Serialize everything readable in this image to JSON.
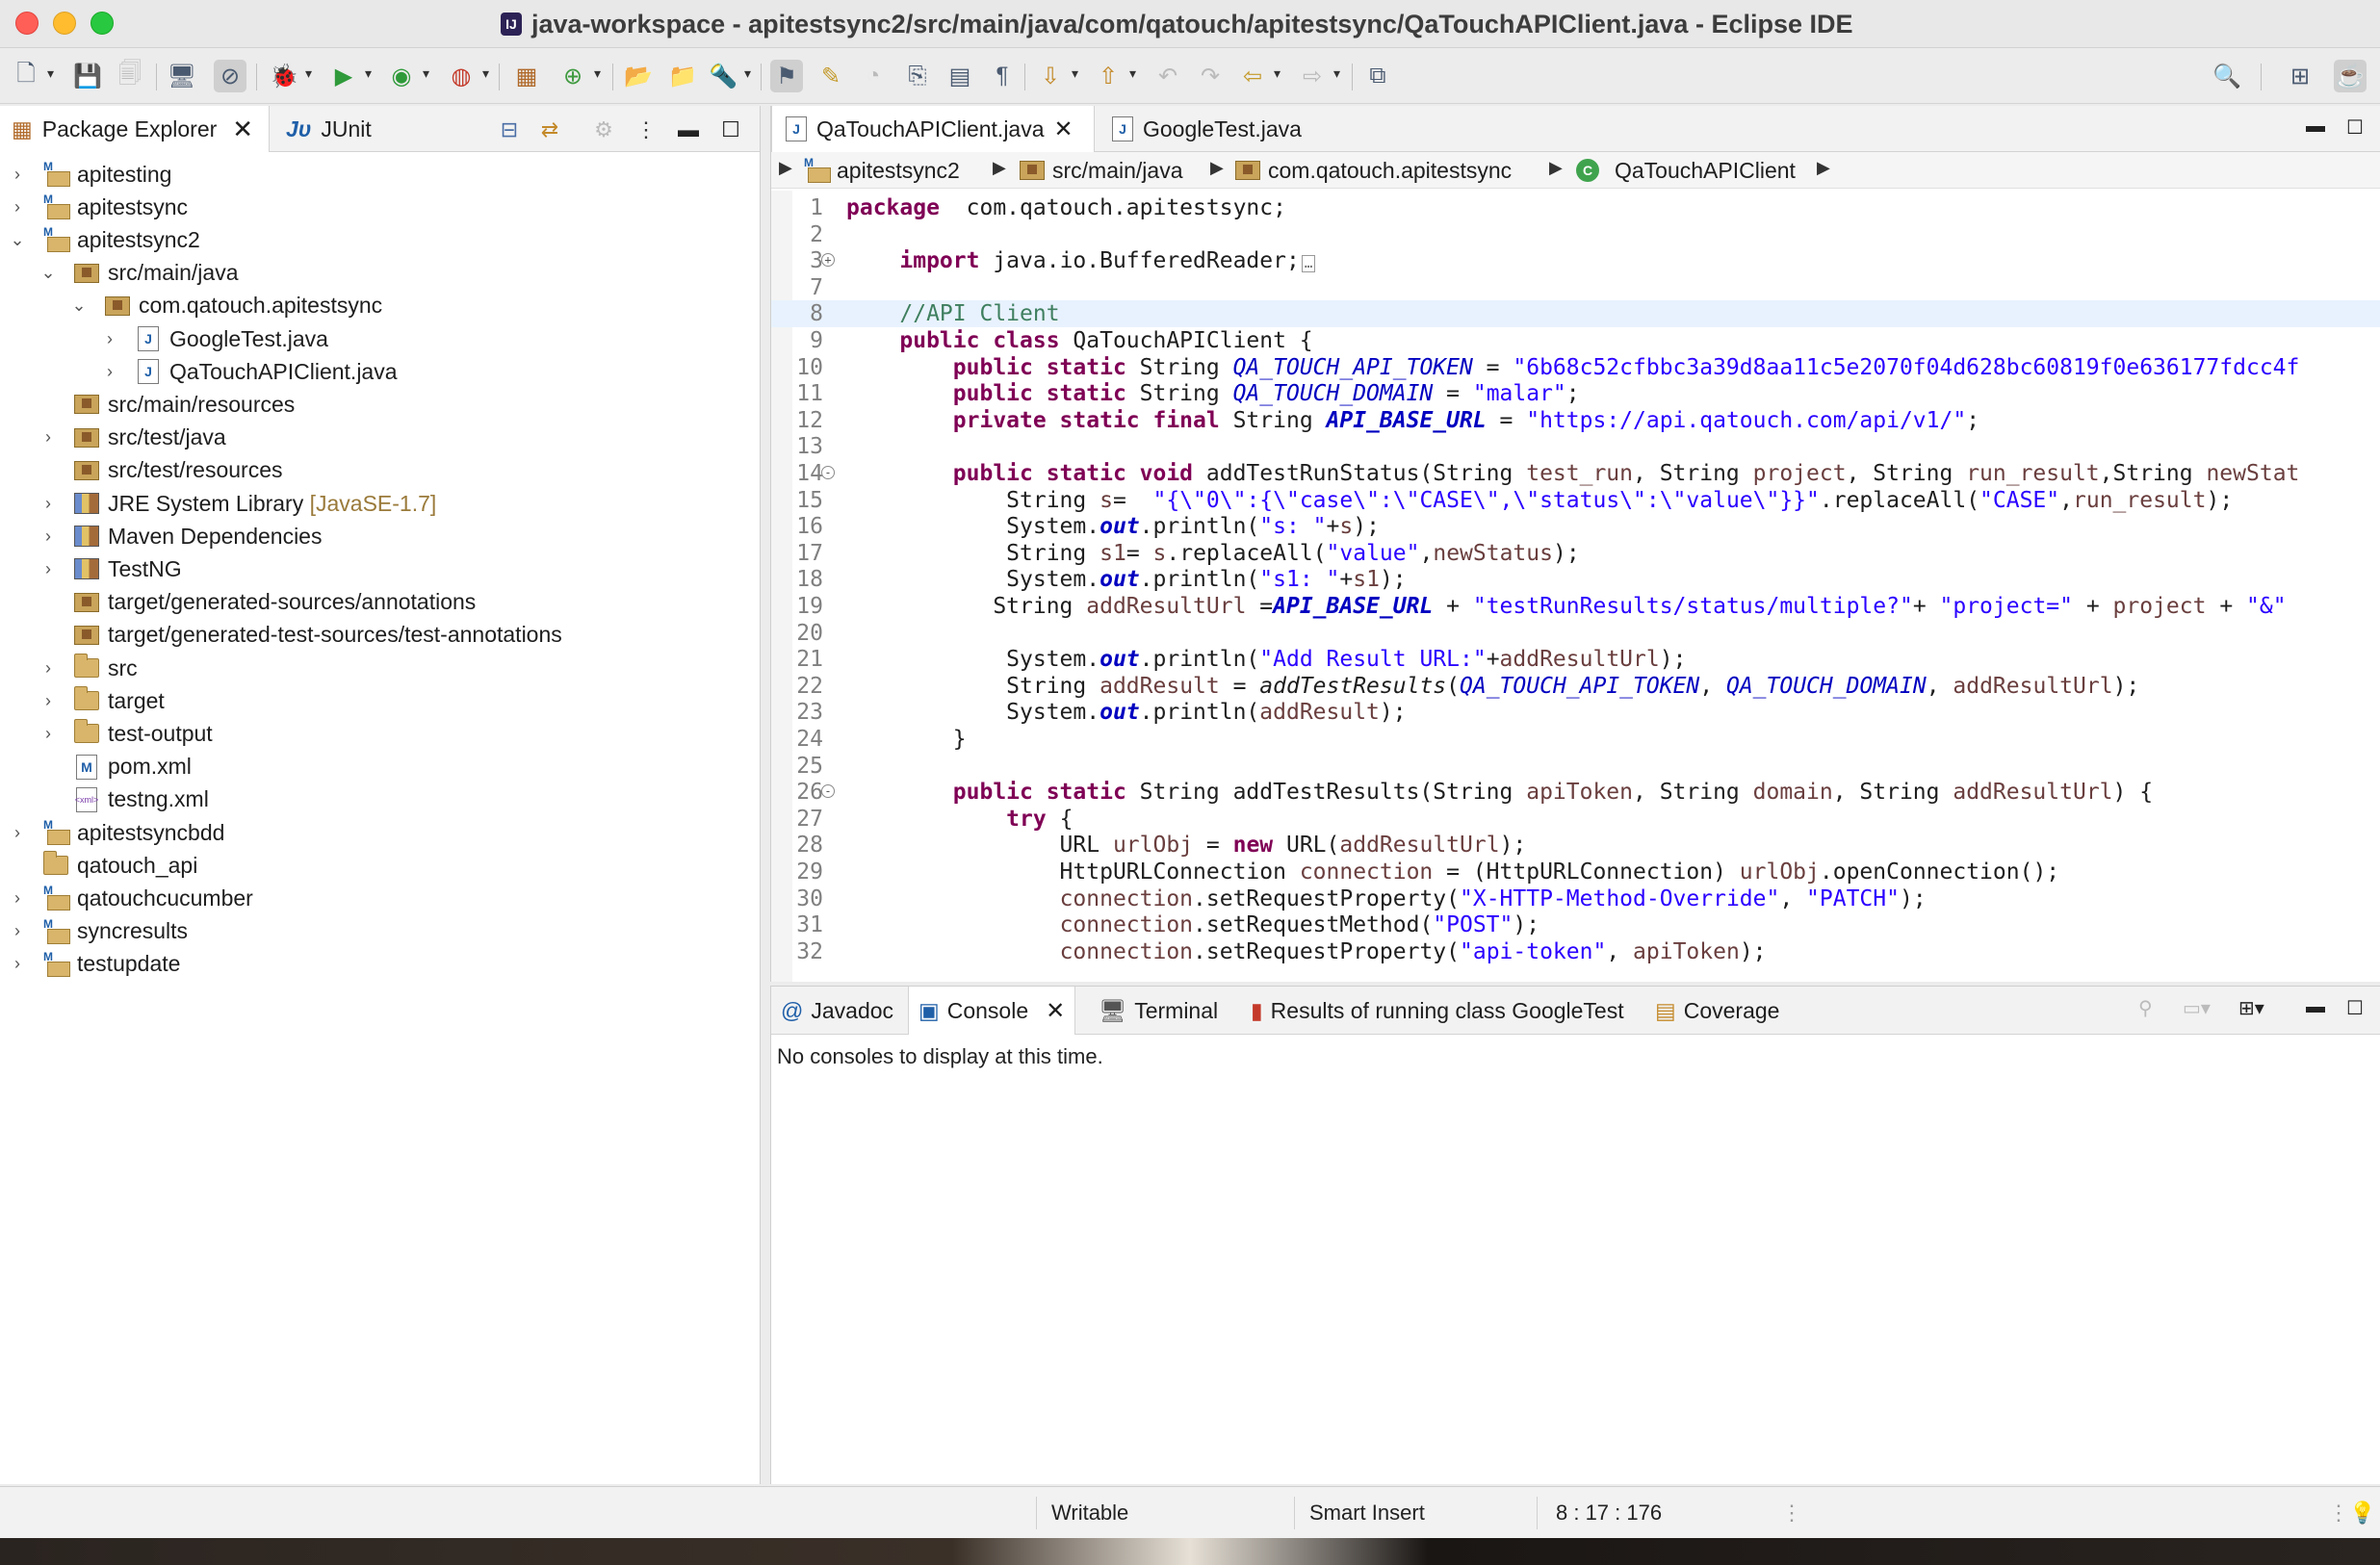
{
  "window": {
    "title": "java-workspace - apitestsync2/src/main/java/com/qatouch/apitestsync/QaTouchAPIClient.java - Eclipse IDE"
  },
  "left_panel": {
    "tabs": [
      {
        "label": "Package Explorer",
        "active": true
      },
      {
        "label": "JUnit",
        "active": false
      }
    ],
    "tree": [
      {
        "label": "apitesting",
        "suffix": "",
        "level": 0,
        "twisty": "›",
        "icon": "project"
      },
      {
        "label": "apitestsync",
        "suffix": "",
        "level": 0,
        "twisty": "›",
        "icon": "project"
      },
      {
        "label": "apitestsync2",
        "suffix": "",
        "level": 0,
        "twisty": "⌄",
        "icon": "project"
      },
      {
        "label": "src/main/java",
        "suffix": "",
        "level": 1,
        "twisty": "⌄",
        "icon": "pkgfolder"
      },
      {
        "label": "com.qatouch.apitestsync",
        "suffix": "",
        "level": 2,
        "twisty": "⌄",
        "icon": "pkgfolder"
      },
      {
        "label": "GoogleTest.java",
        "suffix": "",
        "level": 3,
        "twisty": "›",
        "icon": "jfile"
      },
      {
        "label": "QaTouchAPIClient.java",
        "suffix": "",
        "level": 3,
        "twisty": "›",
        "icon": "jfile"
      },
      {
        "label": "src/main/resources",
        "suffix": "",
        "level": 1,
        "twisty": "",
        "icon": "pkgfolder"
      },
      {
        "label": "src/test/java",
        "suffix": "",
        "level": 1,
        "twisty": "›",
        "icon": "pkgfolder"
      },
      {
        "label": "src/test/resources",
        "suffix": "",
        "level": 1,
        "twisty": "",
        "icon": "pkgfolder"
      },
      {
        "label": "JRE System Library ",
        "suffix": "[JavaSE-1.7]",
        "level": 1,
        "twisty": "›",
        "icon": "lib"
      },
      {
        "label": "Maven Dependencies",
        "suffix": "",
        "level": 1,
        "twisty": "›",
        "icon": "lib"
      },
      {
        "label": "TestNG",
        "suffix": "",
        "level": 1,
        "twisty": "›",
        "icon": "lib"
      },
      {
        "label": "target/generated-sources/annotations",
        "suffix": "",
        "level": 1,
        "twisty": "",
        "icon": "pkgfolder"
      },
      {
        "label": "target/generated-test-sources/test-annotations",
        "suffix": "",
        "level": 1,
        "twisty": "",
        "icon": "pkgfolder"
      },
      {
        "label": "src",
        "suffix": "",
        "level": 1,
        "twisty": "›",
        "icon": "folder"
      },
      {
        "label": "target",
        "suffix": "",
        "level": 1,
        "twisty": "›",
        "icon": "folder"
      },
      {
        "label": "test-output",
        "suffix": "",
        "level": 1,
        "twisty": "›",
        "icon": "folder"
      },
      {
        "label": "pom.xml",
        "suffix": "",
        "level": 1,
        "twisty": "",
        "icon": "pomfile"
      },
      {
        "label": "testng.xml",
        "suffix": "",
        "level": 1,
        "twisty": "",
        "icon": "xmlfile"
      },
      {
        "label": "apitestsyncbdd",
        "suffix": "",
        "level": 0,
        "twisty": "›",
        "icon": "project"
      },
      {
        "label": "qatouch_api",
        "suffix": "",
        "level": 0,
        "twisty": "",
        "icon": "folder"
      },
      {
        "label": "qatouchcucumber",
        "suffix": "",
        "level": 0,
        "twisty": "›",
        "icon": "project"
      },
      {
        "label": "syncresults",
        "suffix": "",
        "level": 0,
        "twisty": "›",
        "icon": "project"
      },
      {
        "label": "testupdate",
        "suffix": "",
        "level": 0,
        "twisty": "›",
        "icon": "project"
      }
    ]
  },
  "editor": {
    "tabs": [
      {
        "label": "QaTouchAPIClient.java",
        "active": true
      },
      {
        "label": "GoogleTest.java",
        "active": false
      }
    ],
    "breadcrumb": [
      "apitestsync2",
      "src/main/java",
      "com.qatouch.apitestsync",
      "QaTouchAPIClient"
    ],
    "current_line": 8,
    "lines": [
      {
        "n": "1",
        "fold": "",
        "segs": [
          [
            "kw",
            "package"
          ],
          [
            "",
            "  com.qatouch.apitestsync;"
          ]
        ]
      },
      {
        "n": "2",
        "fold": "",
        "segs": []
      },
      {
        "n": "3",
        "fold": "+",
        "segs": [
          [
            "",
            "    "
          ],
          [
            "kw",
            "import"
          ],
          [
            "",
            " java.io.BufferedReader;"
          ],
          [
            "box",
            "…"
          ]
        ]
      },
      {
        "n": "7",
        "fold": "",
        "segs": []
      },
      {
        "n": "8",
        "fold": "",
        "segs": [
          [
            "",
            "    "
          ],
          [
            "cm",
            "//API Client"
          ]
        ]
      },
      {
        "n": "9",
        "fold": "",
        "segs": [
          [
            "",
            "    "
          ],
          [
            "kw",
            "public class"
          ],
          [
            "",
            " QaTouchAPIClient {"
          ]
        ]
      },
      {
        "n": "10",
        "fold": "",
        "segs": [
          [
            "",
            "        "
          ],
          [
            "kw",
            "public static"
          ],
          [
            "",
            " String "
          ],
          [
            "sf",
            "QA_TOUCH_API_TOKEN"
          ],
          [
            "",
            " = "
          ],
          [
            "str",
            "\"6b68c52cfbbc3a39d8aa11c5e2070f04d628bc60819f0e636177fdcc4f"
          ]
        ]
      },
      {
        "n": "11",
        "fold": "",
        "segs": [
          [
            "",
            "        "
          ],
          [
            "kw",
            "public static"
          ],
          [
            "",
            " String "
          ],
          [
            "sf",
            "QA_TOUCH_DOMAIN"
          ],
          [
            "",
            " = "
          ],
          [
            "str",
            "\"malar\""
          ],
          [
            "",
            ";"
          ]
        ]
      },
      {
        "n": "12",
        "fold": "",
        "segs": [
          [
            "",
            "        "
          ],
          [
            "kw",
            "private static final"
          ],
          [
            "",
            " String "
          ],
          [
            "sfb",
            "API_BASE_URL"
          ],
          [
            "",
            " = "
          ],
          [
            "str",
            "\"https://api.qatouch.com/api/v1/\""
          ],
          [
            "",
            ";"
          ]
        ]
      },
      {
        "n": "13",
        "fold": "",
        "segs": []
      },
      {
        "n": "14",
        "fold": "-",
        "segs": [
          [
            "",
            "        "
          ],
          [
            "kw",
            "public static void"
          ],
          [
            "",
            " addTestRunStatus(String "
          ],
          [
            "var",
            "test_run"
          ],
          [
            "",
            ", String "
          ],
          [
            "var",
            "project"
          ],
          [
            "",
            ", String "
          ],
          [
            "var",
            "run_result"
          ],
          [
            "",
            ",String "
          ],
          [
            "var",
            "newStat"
          ]
        ]
      },
      {
        "n": "15",
        "fold": "",
        "segs": [
          [
            "",
            "            String "
          ],
          [
            "var",
            "s"
          ],
          [
            "",
            "=  "
          ],
          [
            "str",
            "\"{\\\"0\\\":{\\\"case\\\":\\\"CASE\\\",\\\"status\\\":\\\"value\\\"}}\""
          ],
          [
            "",
            ".replaceAll("
          ],
          [
            "str",
            "\"CASE\""
          ],
          [
            "",
            ","
          ],
          [
            "var",
            "run_result"
          ],
          [
            "",
            ");"
          ]
        ]
      },
      {
        "n": "16",
        "fold": "",
        "segs": [
          [
            "",
            "            System."
          ],
          [
            "sfb",
            "out"
          ],
          [
            "",
            ".println("
          ],
          [
            "str",
            "\"s: \""
          ],
          [
            "",
            "+"
          ],
          [
            "var",
            "s"
          ],
          [
            "",
            ");"
          ]
        ]
      },
      {
        "n": "17",
        "fold": "",
        "segs": [
          [
            "",
            "            String "
          ],
          [
            "var",
            "s1"
          ],
          [
            "",
            "= "
          ],
          [
            "var",
            "s"
          ],
          [
            "",
            ".replaceAll("
          ],
          [
            "str",
            "\"value\""
          ],
          [
            "",
            ","
          ],
          [
            "var",
            "newStatus"
          ],
          [
            "",
            ");"
          ]
        ]
      },
      {
        "n": "18",
        "fold": "",
        "segs": [
          [
            "",
            "            System."
          ],
          [
            "sfb",
            "out"
          ],
          [
            "",
            ".println("
          ],
          [
            "str",
            "\"s1: \""
          ],
          [
            "",
            "+"
          ],
          [
            "var",
            "s1"
          ],
          [
            "",
            ");"
          ]
        ]
      },
      {
        "n": "19",
        "fold": "",
        "segs": [
          [
            "",
            "           String "
          ],
          [
            "var",
            "addResultUrl"
          ],
          [
            "",
            " ="
          ],
          [
            "sfb",
            "API_BASE_URL"
          ],
          [
            "",
            " + "
          ],
          [
            "str",
            "\"testRunResults/status/multiple?\""
          ],
          [
            "",
            "+ "
          ],
          [
            "str",
            "\"project=\""
          ],
          [
            "",
            " + "
          ],
          [
            "var",
            "project"
          ],
          [
            "",
            " + "
          ],
          [
            "str",
            "\"&\""
          ]
        ]
      },
      {
        "n": "20",
        "fold": "",
        "segs": []
      },
      {
        "n": "21",
        "fold": "",
        "segs": [
          [
            "",
            "            System."
          ],
          [
            "sfb",
            "out"
          ],
          [
            "",
            ".println("
          ],
          [
            "str",
            "\"Add Result URL:\""
          ],
          [
            "",
            "+"
          ],
          [
            "var",
            "addResultUrl"
          ],
          [
            "",
            ");"
          ]
        ]
      },
      {
        "n": "22",
        "fold": "",
        "segs": [
          [
            "",
            "            String "
          ],
          [
            "var",
            "addResult"
          ],
          [
            "",
            " = "
          ],
          [
            "it",
            "addTestResults"
          ],
          [
            "",
            "("
          ],
          [
            "sf",
            "QA_TOUCH_API_TOKEN"
          ],
          [
            "",
            ", "
          ],
          [
            "sf",
            "QA_TOUCH_DOMAIN"
          ],
          [
            "",
            ", "
          ],
          [
            "var",
            "addResultUrl"
          ],
          [
            "",
            ");"
          ]
        ]
      },
      {
        "n": "23",
        "fold": "",
        "segs": [
          [
            "",
            "            System."
          ],
          [
            "sfb",
            "out"
          ],
          [
            "",
            ".println("
          ],
          [
            "var",
            "addResult"
          ],
          [
            "",
            ");"
          ]
        ]
      },
      {
        "n": "24",
        "fold": "",
        "segs": [
          [
            "",
            "        }"
          ]
        ]
      },
      {
        "n": "25",
        "fold": "",
        "segs": []
      },
      {
        "n": "26",
        "fold": "-",
        "segs": [
          [
            "",
            "        "
          ],
          [
            "kw",
            "public static"
          ],
          [
            "",
            " String addTestResults(String "
          ],
          [
            "var",
            "apiToken"
          ],
          [
            "",
            ", String "
          ],
          [
            "var",
            "domain"
          ],
          [
            "",
            ", String "
          ],
          [
            "var",
            "addResultUrl"
          ],
          [
            "",
            ") {"
          ]
        ]
      },
      {
        "n": "27",
        "fold": "",
        "segs": [
          [
            "",
            "            "
          ],
          [
            "kw",
            "try"
          ],
          [
            "",
            " {"
          ]
        ]
      },
      {
        "n": "28",
        "fold": "",
        "segs": [
          [
            "",
            "                URL "
          ],
          [
            "var",
            "urlObj"
          ],
          [
            "",
            " = "
          ],
          [
            "kw",
            "new"
          ],
          [
            "",
            " URL("
          ],
          [
            "var",
            "addResultUrl"
          ],
          [
            "",
            ");"
          ]
        ]
      },
      {
        "n": "29",
        "fold": "",
        "segs": [
          [
            "",
            "                HttpURLConnection "
          ],
          [
            "var",
            "connection"
          ],
          [
            "",
            " = (HttpURLConnection) "
          ],
          [
            "var",
            "urlObj"
          ],
          [
            "",
            ".openConnection();"
          ]
        ]
      },
      {
        "n": "30",
        "fold": "",
        "segs": [
          [
            "",
            "                "
          ],
          [
            "var",
            "connection"
          ],
          [
            "",
            ".setRequestProperty("
          ],
          [
            "str",
            "\"X-HTTP-Method-Override\""
          ],
          [
            "",
            ", "
          ],
          [
            "str",
            "\"PATCH\""
          ],
          [
            "",
            ");"
          ]
        ]
      },
      {
        "n": "31",
        "fold": "",
        "segs": [
          [
            "",
            "                "
          ],
          [
            "var",
            "connection"
          ],
          [
            "",
            ".setRequestMethod("
          ],
          [
            "str",
            "\"POST\""
          ],
          [
            "",
            ");"
          ]
        ]
      },
      {
        "n": "32",
        "fold": "",
        "segs": [
          [
            "",
            "                "
          ],
          [
            "var",
            "connection"
          ],
          [
            "",
            ".setRequestProperty("
          ],
          [
            "str",
            "\"api-token\""
          ],
          [
            "",
            ", "
          ],
          [
            "var",
            "apiToken"
          ],
          [
            "",
            ");"
          ]
        ]
      }
    ]
  },
  "bottom_panel": {
    "tabs": [
      {
        "label": "Javadoc",
        "icon": "@",
        "active": false
      },
      {
        "label": "Console",
        "icon": "console",
        "active": true
      },
      {
        "label": "Terminal",
        "icon": "terminal",
        "active": false
      },
      {
        "label": "Results of running class GoogleTest",
        "icon": "testng",
        "active": false
      },
      {
        "label": "Coverage",
        "icon": "coverage",
        "active": false
      }
    ],
    "message": "No consoles to display at this time."
  },
  "statusbar": {
    "writable": "Writable",
    "insert_mode": "Smart Insert",
    "position": "8 : 17 : 176"
  }
}
